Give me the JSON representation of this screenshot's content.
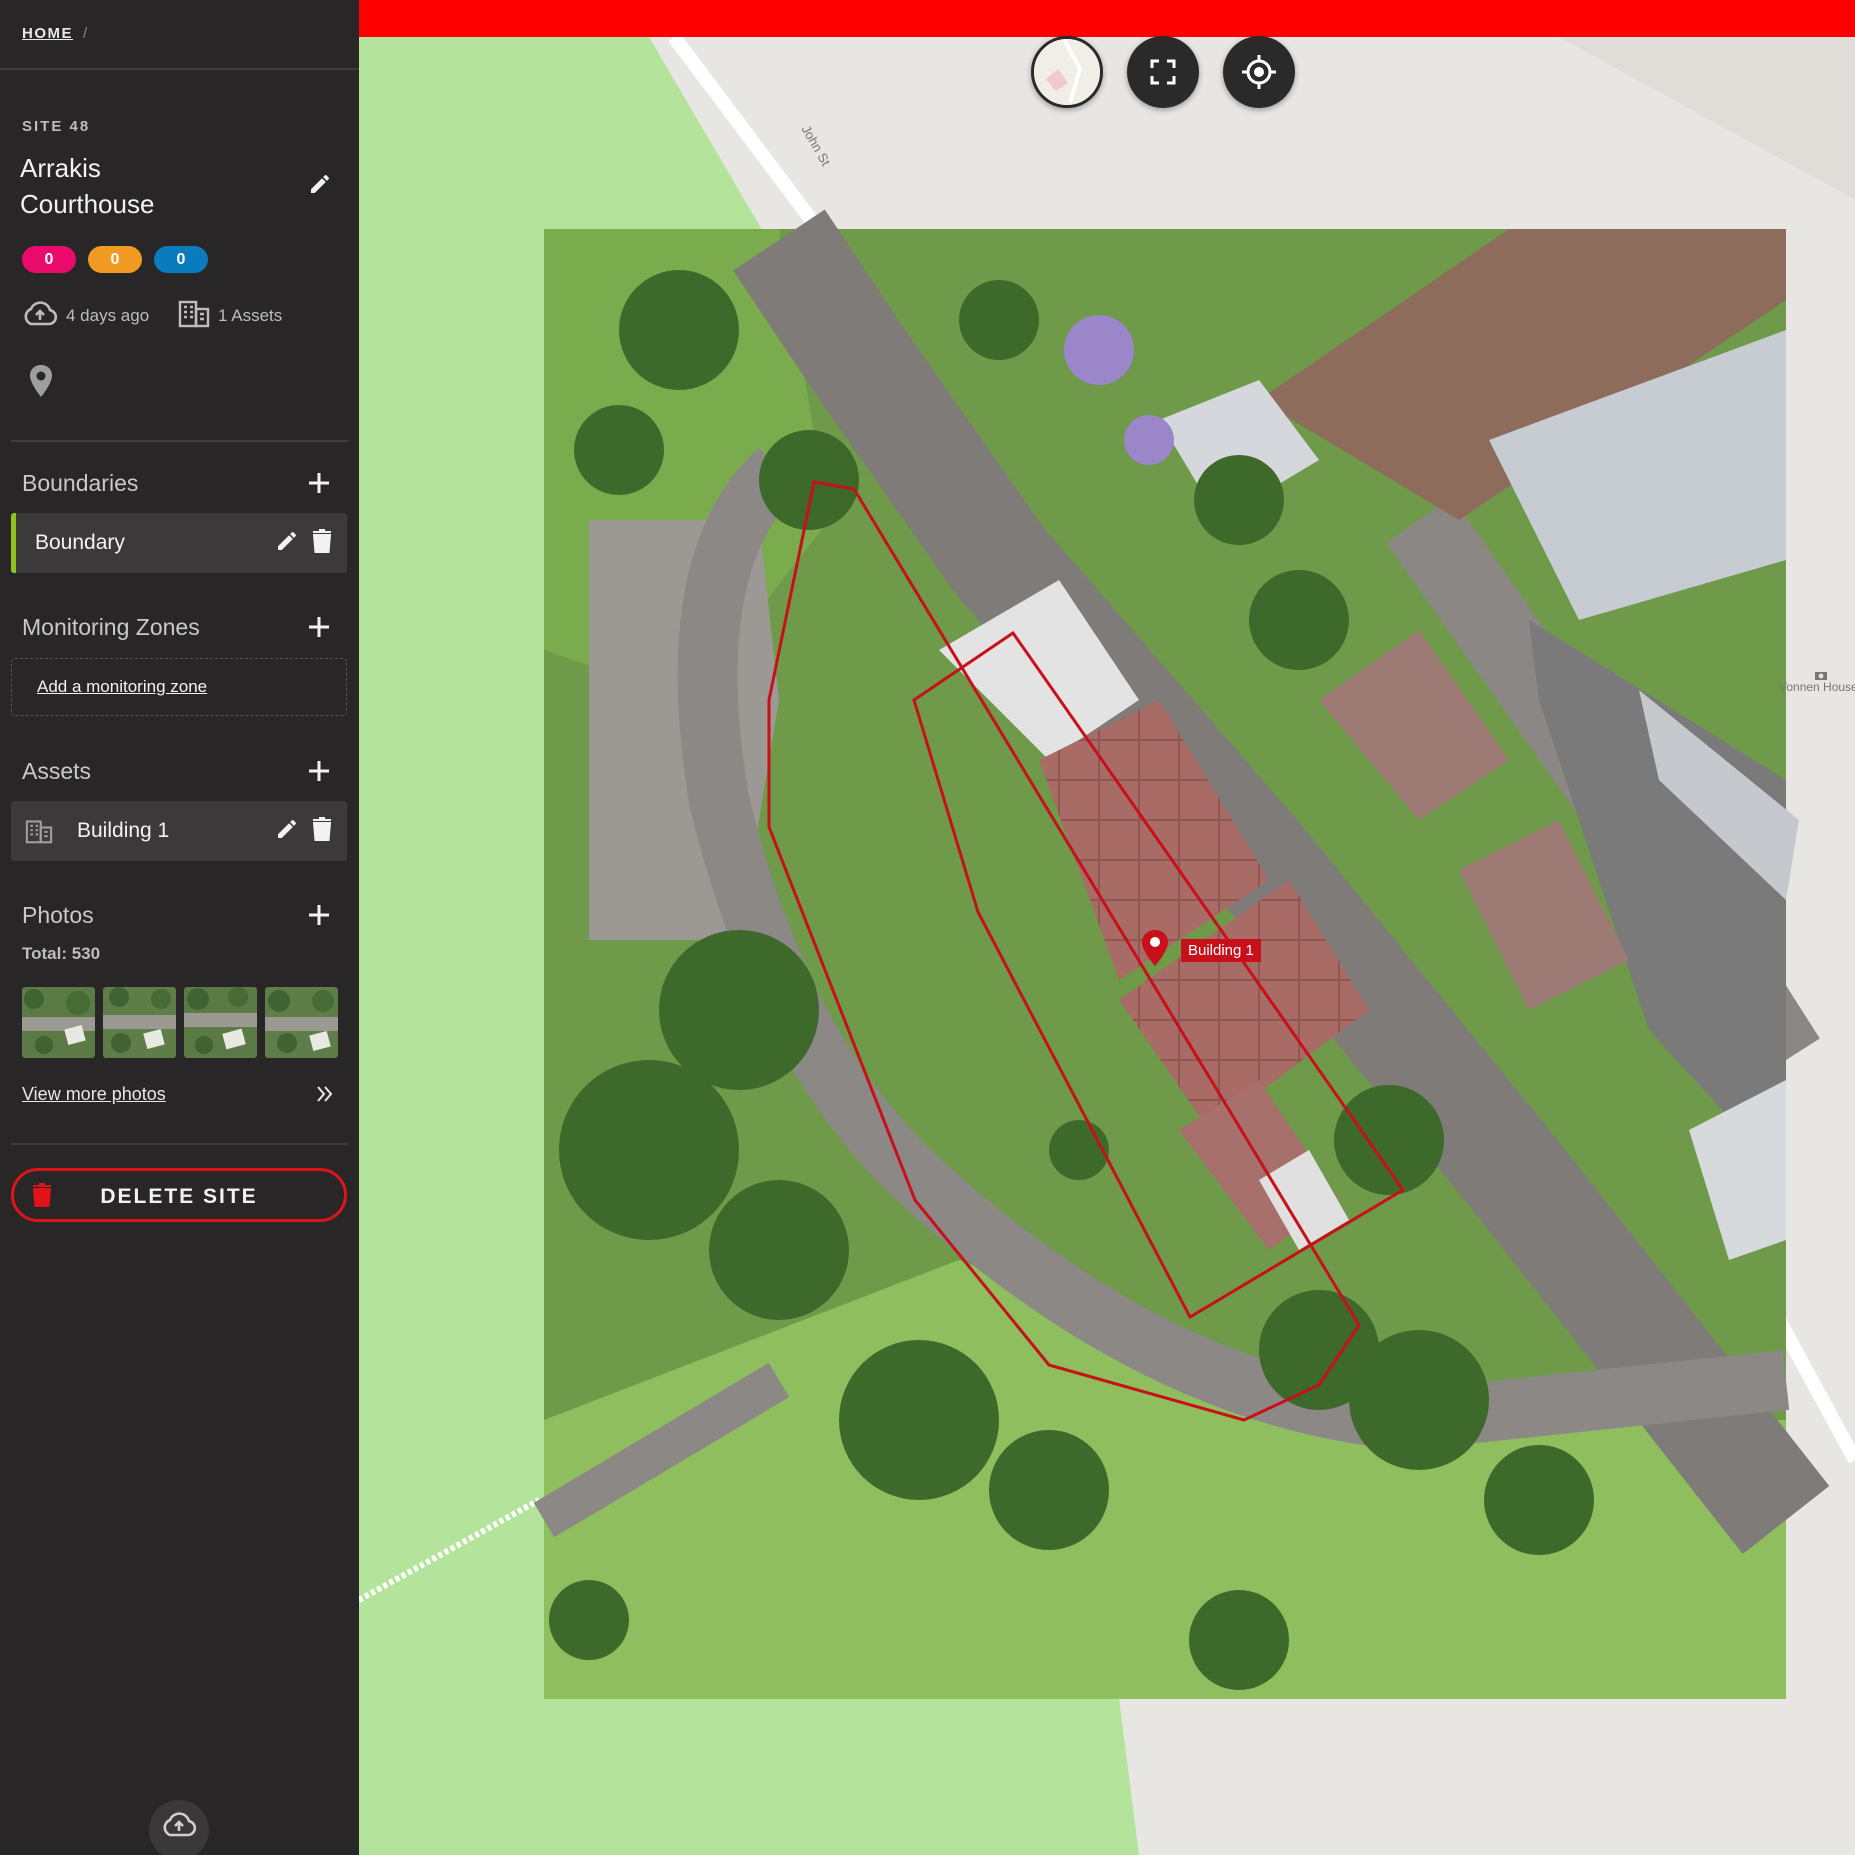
{
  "breadcrumb": {
    "home": "HOME",
    "separator": "/"
  },
  "site": {
    "number": "SITE 48",
    "name": "Arrakis Courthouse",
    "counts": [
      {
        "value": "0",
        "color": "#ea0a6b"
      },
      {
        "value": "0",
        "color": "#f09a22"
      },
      {
        "value": "0",
        "color": "#0a7bbd"
      }
    ],
    "uploaded": "4 days ago",
    "assets_count": "1 Assets"
  },
  "boundaries": {
    "title": "Boundaries",
    "items": [
      {
        "label": "Boundary"
      }
    ]
  },
  "monitoring_zones": {
    "title": "Monitoring Zones",
    "add_link": "Add a monitoring zone"
  },
  "assets": {
    "title": "Assets",
    "items": [
      {
        "label": "Building 1"
      }
    ]
  },
  "photos": {
    "title": "Photos",
    "total": "Total: 530",
    "view_more": "View more photos"
  },
  "delete_site": "DELETE SITE",
  "map": {
    "street_label": "John St",
    "poi_label": "Vonnen House",
    "marker_label": "Building 1",
    "boundary_color": "#c8101b",
    "accent_bar_color": "#ff0000"
  },
  "icons": {
    "edit": "pencil-icon",
    "add": "plus-icon",
    "delete": "trash-icon",
    "upload": "cloud-upload-icon",
    "buildings": "building-icon",
    "location": "map-pin-icon",
    "fullscreen": "fullscreen-icon",
    "locate": "crosshair-icon"
  }
}
